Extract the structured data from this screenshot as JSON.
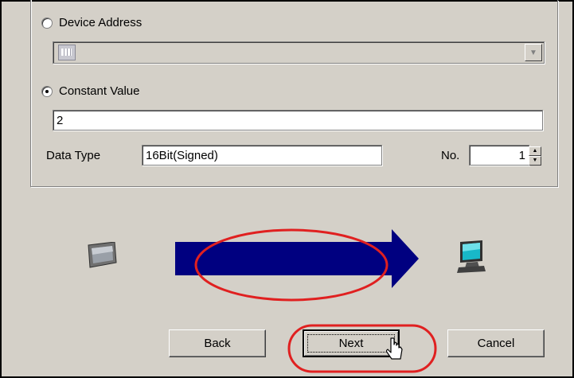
{
  "source": {
    "device_address_label": "Device Address",
    "constant_value_label": "Constant Value",
    "constant_value": "2",
    "selected_option": "Constant Value"
  },
  "data_type": {
    "label": "Data Type",
    "value": "16Bit(Signed)"
  },
  "count": {
    "label": "No.",
    "value": "1"
  },
  "buttons": {
    "back": "Back",
    "next": "Next",
    "cancel": "Cancel"
  },
  "icons": [
    "table-grid-icon",
    "chevron-down-icon",
    "panel-device-icon",
    "arrow-right-icon",
    "pc-monitor-icon",
    "mouse-cursor-icon"
  ],
  "colors": {
    "window_bg": "#d4d0c8",
    "arrow": "#000080",
    "highlight": "#e02020"
  }
}
